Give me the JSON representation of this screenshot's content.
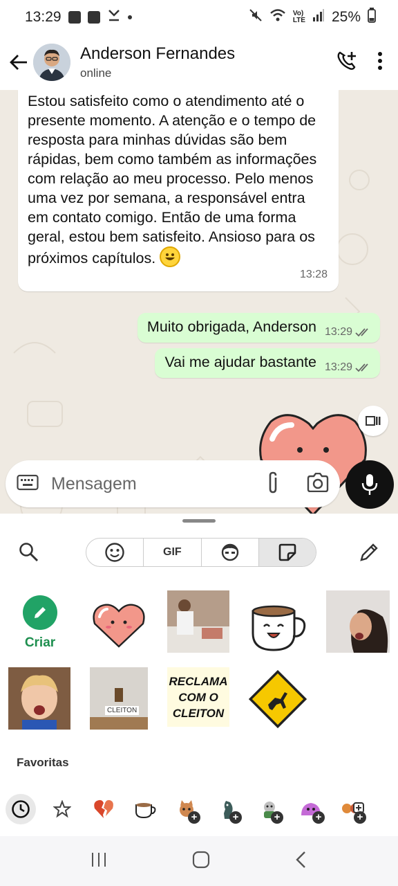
{
  "status_bar": {
    "time": "13:29",
    "battery": "25%"
  },
  "header": {
    "contact_name": "Anderson Fernandes",
    "contact_status": "online"
  },
  "messages": {
    "incoming": {
      "text": "Estou satisfeito como o atendimento até o presente momento. A atenção e o tempo de resposta para minhas dúvidas são bem rápidas, bem como também as informações com relação ao meu processo. Pelo menos uma vez por semana, a responsável entra em contato comigo. Então de uma forma geral, estou bem satisfeito. Ansioso para os próximos capítulos.",
      "time": "13:28"
    },
    "outgoing": [
      {
        "text": "Muito obrigada, Anderson",
        "time": "13:29"
      },
      {
        "text": "Vai me ajudar bastante",
        "time": "13:29"
      }
    ]
  },
  "composer": {
    "placeholder": "Mensagem"
  },
  "sticker_panel": {
    "tabs": [
      "emoji",
      "GIF",
      "avatar",
      "sticker"
    ],
    "active_tab": "sticker",
    "criar_label": "Criar",
    "reclama_text": [
      "RECLAMA",
      "COM O",
      "CLEITON"
    ],
    "cleiton_sign": "CLEITON",
    "favorites_label": "Favoritas"
  },
  "icons": {
    "back": "arrow-left-icon",
    "add_call": "add-call-icon",
    "more": "more-vert-icon",
    "keyboard": "keyboard-icon",
    "attach": "paperclip-icon",
    "camera": "camera-icon",
    "mic": "mic-icon"
  },
  "colors": {
    "chat_bg": "#efeae2",
    "outgoing_bubble": "#d9fdd3",
    "accent_green": "#21a366",
    "mic_button": "#111111"
  }
}
